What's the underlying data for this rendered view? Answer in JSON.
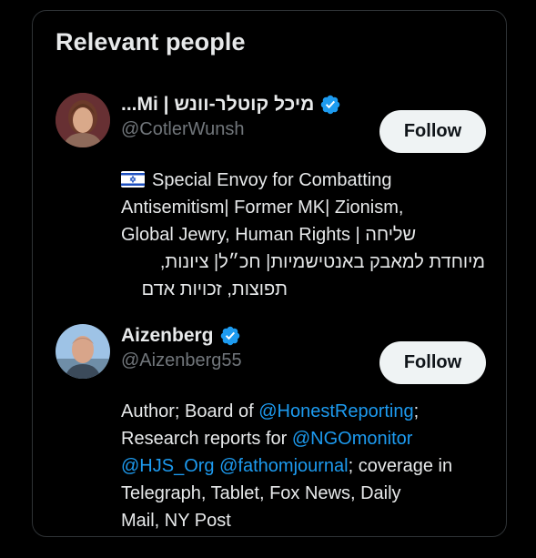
{
  "section": {
    "title": "Relevant people"
  },
  "people": [
    {
      "name": "מיכל קוטלר-וונש | Mi...",
      "handle": "@CotlerWunsh",
      "follow_label": "Follow",
      "verified": true,
      "avatar_icon": "avatar-woman-photo",
      "bio": {
        "flag_icon": "israel-flag-icon",
        "line1": "Special Envoy for Combatting",
        "line2": "Antisemitism| Former MK| Zionism,",
        "line3_ltr": "Global Jewry, Human Rights |",
        "line3_rtl": "שליחה",
        "line4": "מיוחדת למאבק באנטישמיות| חכ״ל| ציונות,",
        "line5": "תפוצות, זכויות אדם"
      }
    },
    {
      "name": "Aizenberg",
      "handle": "@Aizenberg55",
      "follow_label": "Follow",
      "verified": true,
      "avatar_icon": "avatar-man-photo",
      "bio": {
        "t1": "Author; Board of ",
        "m1": "@HonestReporting",
        "t2": ";",
        "t3": "Research reports for ",
        "m2": "@NGOmonitor",
        "m3": "@HJS_Org",
        "t4": " ",
        "m4": "@fathomjournal",
        "t5": "; coverage in",
        "t6": "Telegraph, Tablet, Fox News, Daily",
        "t7": "Mail, NY Post"
      }
    }
  ],
  "colors": {
    "background": "#000000",
    "text_primary": "#e7e9ea",
    "text_secondary": "#71767b",
    "link": "#1d9bf0",
    "verified_badge": "#1d9bf0",
    "follow_button_bg": "#eff3f4",
    "border": "#2f3336"
  }
}
